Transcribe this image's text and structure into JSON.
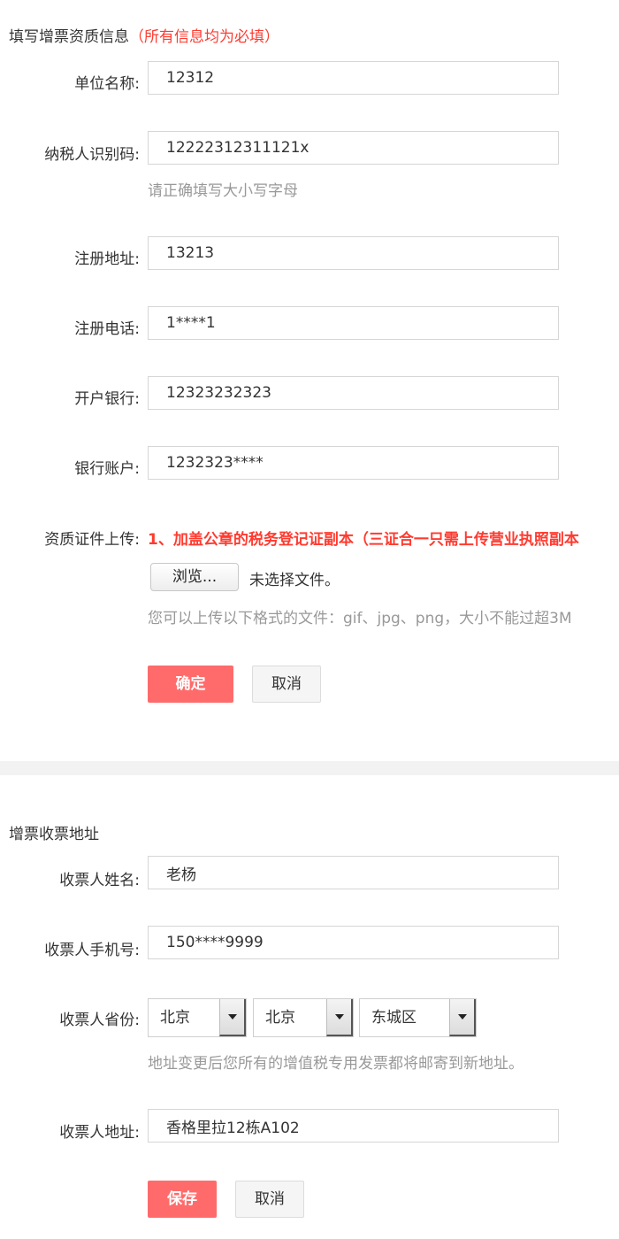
{
  "invoice_section": {
    "title": "填写增票资质信息",
    "required_note": "（所有信息均为必填）",
    "fields": {
      "company_name": {
        "label": "单位名称:",
        "value": "12312"
      },
      "taxpayer_id": {
        "label": "纳税人识别码:",
        "value": "12222312311121x",
        "hint": "请正确填写大小写字母"
      },
      "reg_address": {
        "label": "注册地址:",
        "value": "13213"
      },
      "reg_phone": {
        "label": "注册电话:",
        "value": "1****1"
      },
      "bank": {
        "label": "开户银行:",
        "value": "12323232323"
      },
      "bank_account": {
        "label": "银行账户:",
        "value": "1232323****"
      }
    },
    "upload": {
      "label": "资质证件上传:",
      "note": "1、加盖公章的税务登记证副本（三证合一只需上传营业执照副本",
      "browse_label": "浏览...",
      "file_status": "未选择文件。",
      "hint": "您可以上传以下格式的文件：gif、jpg、png，大小不能过超3M"
    },
    "confirm_label": "确定",
    "cancel_label": "取消"
  },
  "address_section": {
    "title": "增票收票地址",
    "fields": {
      "recipient_name": {
        "label": "收票人姓名:",
        "value": "老杨"
      },
      "recipient_phone": {
        "label": "收票人手机号:",
        "value": "150****9999"
      },
      "province": {
        "label": "收票人省份:",
        "province": "北京",
        "city": "北京",
        "district": "东城区",
        "hint": "地址变更后您所有的增值税专用发票都将邮寄到新地址。"
      },
      "recipient_address": {
        "label": "收票人地址:",
        "value": "香格里拉12栋A102"
      }
    },
    "save_label": "保存",
    "cancel_label": "取消"
  },
  "colors": {
    "accent": "#ff6b6b",
    "required": "#ff3b30",
    "hint": "#999999"
  }
}
